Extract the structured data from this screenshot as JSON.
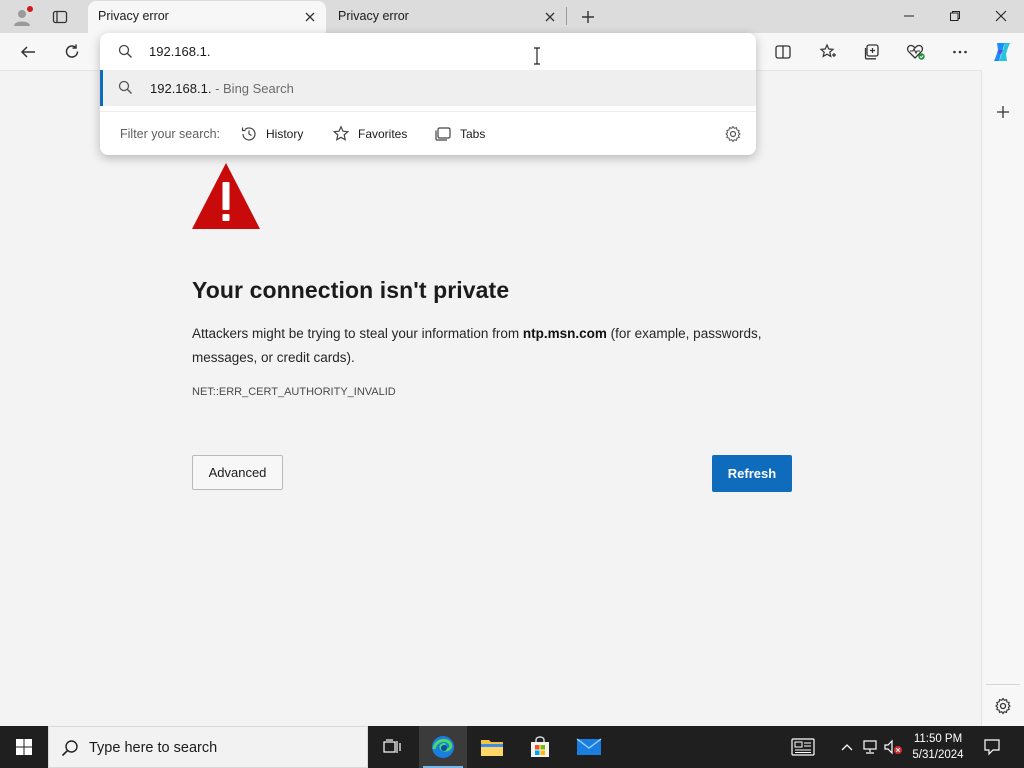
{
  "browser": {
    "tabs": [
      {
        "title": "Privacy error",
        "active": true
      },
      {
        "title": "Privacy error",
        "active": false
      }
    ]
  },
  "omnibox": {
    "input_value": "192.168.1.",
    "suggestion_query": "192.168.1.",
    "suggestion_suffix": " - Bing Search",
    "filter_label": "Filter your search:",
    "filters": [
      "History",
      "Favorites",
      "Tabs"
    ]
  },
  "page": {
    "heading": "Your connection isn't private",
    "desc_before": "Attackers might be trying to steal your information from ",
    "desc_domain": "ntp.msn.com",
    "desc_after": " (for example, passwords, messages, or credit cards).",
    "error_code": "NET::ERR_CERT_AUTHORITY_INVALID",
    "advanced_label": "Advanced",
    "refresh_label": "Refresh"
  },
  "taskbar": {
    "search_placeholder": "Type here to search",
    "time": "11:50 PM",
    "date": "5/31/2024"
  },
  "colors": {
    "accent": "#0f6cbd",
    "warning_red": "#c80a0a",
    "taskbar_bg": "#1f1f1f"
  }
}
